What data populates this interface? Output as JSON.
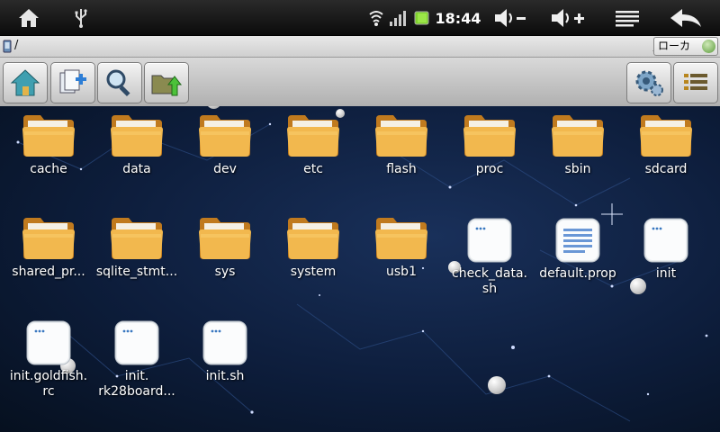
{
  "status_bar": {
    "icons": [
      "home-icon",
      "usb-icon",
      "wifi-icon",
      "signal-icon",
      "battery-icon",
      "volume-down-icon",
      "volume-up-icon",
      "menu-icon",
      "back-icon"
    ],
    "time": "18:44"
  },
  "path_bar": {
    "path": "/",
    "location": "ローカ"
  },
  "toolbar": {
    "left_buttons": [
      "home-icon",
      "new-file-icon",
      "search-icon",
      "folder-up-icon"
    ],
    "right_buttons": [
      "settings-icon",
      "view-mode-icon"
    ]
  },
  "files": [
    {
      "name": "cache",
      "type": "folder"
    },
    {
      "name": "data",
      "type": "folder"
    },
    {
      "name": "dev",
      "type": "folder"
    },
    {
      "name": "etc",
      "type": "folder"
    },
    {
      "name": "flash",
      "type": "folder"
    },
    {
      "name": "proc",
      "type": "folder"
    },
    {
      "name": "sbin",
      "type": "folder"
    },
    {
      "name": "sdcard",
      "type": "folder"
    },
    {
      "name": "shared_pr...",
      "type": "folder"
    },
    {
      "name": "sqlite_stmt...",
      "type": "folder"
    },
    {
      "name": "sys",
      "type": "folder"
    },
    {
      "name": "system",
      "type": "folder"
    },
    {
      "name": "usb1",
      "type": "folder"
    },
    {
      "name": "check_data.\nsh",
      "type": "file"
    },
    {
      "name": "default.prop",
      "type": "text"
    },
    {
      "name": "init",
      "type": "file"
    },
    {
      "name": "init.goldfish.\nrc",
      "type": "file"
    },
    {
      "name": "init.\nrk28board...",
      "type": "file"
    },
    {
      "name": "init.sh",
      "type": "file"
    }
  ],
  "colors": {
    "folder": "#f0b24a",
    "background": "#0d1d3b",
    "battery": "#7fd12d"
  }
}
